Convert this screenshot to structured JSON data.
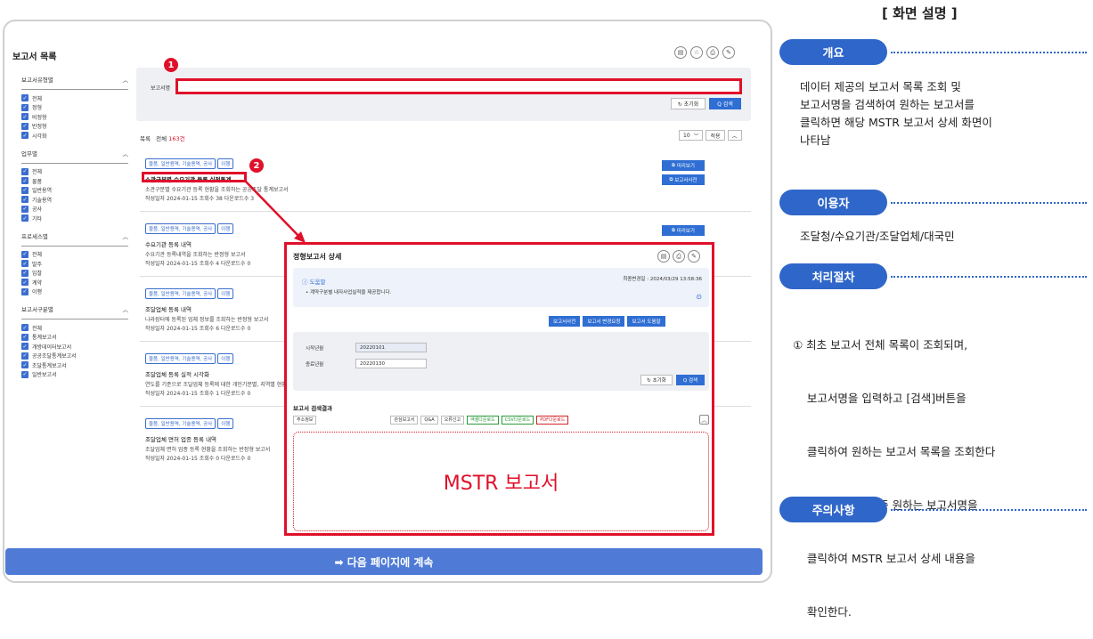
{
  "page_title": "보고서 목록",
  "sidebar": {
    "sections": [
      {
        "title": "보고서유형별",
        "items": [
          "전체",
          "정형",
          "비정형",
          "반정형",
          "시각화"
        ]
      },
      {
        "title": "업무별",
        "items": [
          "전체",
          "물품",
          "일반용역",
          "기술용역",
          "공사",
          "기타"
        ]
      },
      {
        "title": "프로세스별",
        "items": [
          "전체",
          "발주",
          "입찰",
          "계약",
          "이행"
        ]
      },
      {
        "title": "보고서구분별",
        "items": [
          "전체",
          "통계보고서",
          "개방데이터보고서",
          "공공조달통계보고서",
          "조달통계보고서",
          "일반보고서"
        ]
      }
    ]
  },
  "search": {
    "label": "보고서명",
    "reset": "↻ 초기화",
    "search": "Q 검색"
  },
  "list": {
    "label": "목록",
    "total_prefix": "전체",
    "count": "163건",
    "page_size": "10",
    "sort": "적용"
  },
  "items": [
    {
      "tags": [
        "물품, 일반용역, 기술용역, 공사",
        "이행"
      ],
      "title": "소관구분별 수요기관 등록 실적통계",
      "desc": "소관구분별 수요기관 등록 현황을 조회하는 공공조달 통계보고서",
      "meta": "작성일자  2024-01-15     조회수  38     다운로드수  3",
      "btns": [
        "미리보기",
        "보고서사전"
      ]
    },
    {
      "tags": [
        "물품, 일반용역, 기술용역, 공사",
        "이행"
      ],
      "title": "수요기관 등록 내역",
      "desc": "수요기관 등록내역을 조회하는 반정형 보고서",
      "meta": "작성일자  2024-01-15     조회수  4     다운로드수  0",
      "btns": [
        "미리보기"
      ]
    },
    {
      "tags": [
        "물품, 일반용역, 기술용역, 공사",
        "이행"
      ],
      "title": "조달업체 등록 내역",
      "desc": "나라장터에 등록된 업체 정보를 조회하는 반정형 보고서",
      "meta": "작성일자  2024-01-15     조회수  6     다운로드수  0",
      "btns": []
    },
    {
      "tags": [
        "물품, 일반용역, 기술용역, 공사",
        "이행"
      ],
      "title": "조달업체 등록 실적 시각화",
      "desc": "연도를 기준으로 조달업체 등록에 대한 개인기분별, 지역별 현황",
      "meta": "작성일자  2024-01-15     조회수  1     다운로드수  0",
      "btns": []
    },
    {
      "tags": [
        "물품, 일반용역, 기술용역, 공사",
        "이행"
      ],
      "title": "조달업체 면허 업종 등록 내역",
      "desc": "조달업체 면허 업종 등록 현황을 조회하는 반정형 보고서",
      "meta": "작성일자  2024-01-15     조회수  0     다운로드수  0",
      "btns": []
    }
  ],
  "badges": [
    "1",
    "2"
  ],
  "modal": {
    "title": "정형보고서 상세",
    "help_title": "도움말",
    "help_text": "• 계약구분별 내자사업실적을 제공합니다.",
    "updated": "최종변경일 : 2024/03/29 13:58:36",
    "actions": [
      "보고서사전",
      "보고서 변경요청",
      "보고서 도움말"
    ],
    "form": [
      {
        "label": "시작년월",
        "value": "20220101"
      },
      {
        "label": "종료년월",
        "value": "20220130"
      }
    ],
    "reset": "↻ 초기화",
    "search": "Q 검색",
    "result_title": "보고서 검색결과",
    "result_btns": [
      "주소정보",
      "관심보고서",
      "Q&A",
      "오류신고",
      "엑셀다운로드",
      "CSV다운로드",
      "PDF다운로드"
    ],
    "report_label": "MSTR 보고서"
  },
  "next_button": "➡ 다음 페이지에 계속",
  "right": {
    "heading": "[ 화면 설명 ]",
    "overview_title": "개요",
    "overview_text": [
      "데이터 제공의 보고서 목록 조회 및",
      "보고서명을 검색하여 원하는 보고서를",
      "클릭하면 해당 MSTR 보고서 상세 화면이",
      "나타남"
    ],
    "users_title": "이용자",
    "users_text": "조달청/수요기관/조달업체/대국민",
    "process_title": "처리절차",
    "process_text": [
      "① 최초 보고서 전체 목록이 조회되며,",
      "    보고서명을 입력하고 [검색]버튼을",
      "    클릭하여 원하는 보고서 목록을 조회한다",
      "② 조회 결과 목록 중 원하는 보고서명을",
      "    클릭하여 MSTR 보고서 상세 내용을",
      "    확인한다."
    ],
    "notes_title": "주의사항"
  },
  "colors": {
    "accent": "#2f66c9",
    "highlight": "#e0102a"
  }
}
